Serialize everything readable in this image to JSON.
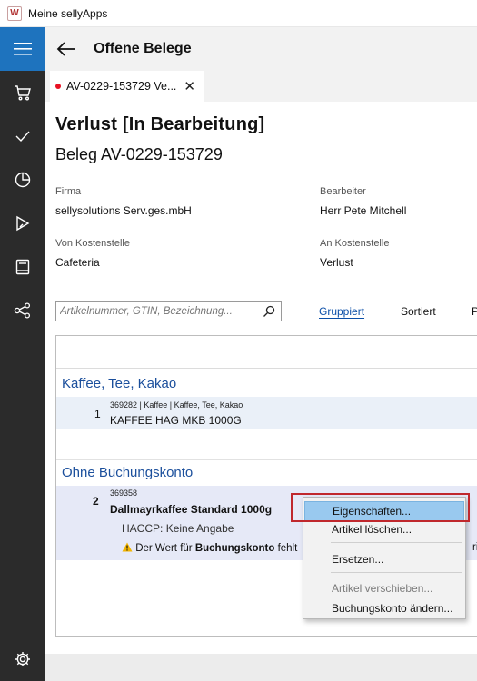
{
  "window": {
    "title": "Meine sellyApps",
    "icon_name": "w-app-icon"
  },
  "sidebar": {
    "items": [
      {
        "icon": "hamburger-icon"
      },
      {
        "icon": "cart-icon"
      },
      {
        "icon": "checkmark-icon"
      },
      {
        "icon": "pie-chart-icon"
      },
      {
        "icon": "pen-play-icon"
      },
      {
        "icon": "book-icon"
      },
      {
        "icon": "share-nodes-icon"
      },
      {
        "icon": "gear-icon"
      }
    ],
    "accent": "#1e73be"
  },
  "header": {
    "title": "Offene Belege"
  },
  "tab": {
    "label": "AV-0229-153729 Ve..."
  },
  "document": {
    "heading": "Verlust [In Bearbeitung]",
    "subheading": "Beleg AV-0229-153729",
    "fields": {
      "firma_label": "Firma",
      "firma_value": "sellysolutions Serv.ges.mbH",
      "bearbeiter_label": "Bearbeiter",
      "bearbeiter_value": "Herr Pete Mitchell",
      "von_label": "Von Kostenstelle",
      "von_value": "Cafeteria",
      "an_label": "An Kostenstelle",
      "an_value": "Verlust"
    }
  },
  "search": {
    "placeholder": "Artikelnummer, GTIN, Bezeichnung..."
  },
  "view_tabs": [
    "Gruppiert",
    "Sortiert",
    "P"
  ],
  "groups": [
    {
      "title": "Kaffee, Tee, Kakao",
      "rows": [
        {
          "num": "1",
          "meta": "369282 | Kaffee | Kaffee, Tee, Kakao",
          "name": "KAFFEE HAG MKB 1000G"
        }
      ]
    },
    {
      "title": "Ohne Buchungskonto",
      "rows": [
        {
          "num": "2",
          "meta": "369358",
          "name": "Dallmayrkaffee Standard 1000g",
          "haccp_label": "HACCP:",
          "haccp_value": "Keine Angabe",
          "warning_prefix": "Der Wert für",
          "warning_bold": "Buchungskonto",
          "warning_suffix": "fehlt",
          "warning_cut": "rig"
        }
      ]
    }
  ],
  "context_menu": {
    "items": [
      "Eigenschaften...",
      "Artikel löschen...",
      "Ersetzen...",
      "Artikel verschieben...",
      "Buchungskonto ändern..."
    ],
    "highlight_color": "#c0282d"
  }
}
